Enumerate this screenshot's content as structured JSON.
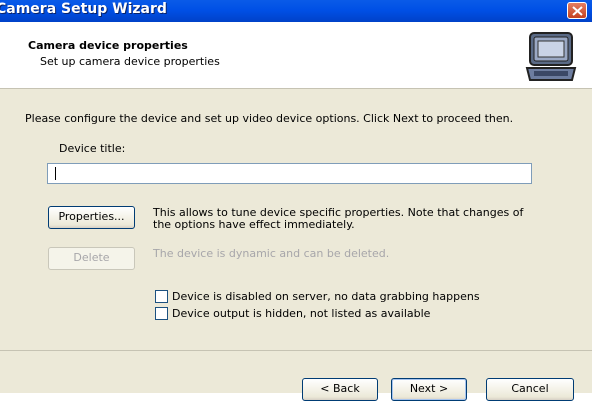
{
  "window": {
    "title": "Camera Setup Wizard"
  },
  "header": {
    "title": "Camera device properties",
    "subtitle": "Set up camera device properties",
    "icon": "camera-case-icon"
  },
  "content": {
    "intro": "Please configure the device and set up video device options. Click Next to proceed then.",
    "device_title_label": "Device title:",
    "device_title_value": "",
    "properties_button": "Properties...",
    "properties_desc": "This allows to tune device specific properties. Note that changes of the options have effect immediately.",
    "delete_button": "Delete",
    "delete_desc": "The device is dynamic and can be deleted.",
    "checkboxes": [
      {
        "label": "Device is disabled on server, no data grabbing happens",
        "checked": false
      },
      {
        "label": "Device output is hidden, not listed as available",
        "checked": false
      }
    ]
  },
  "footer": {
    "back": "< Back",
    "next": "Next >",
    "cancel": "Cancel"
  },
  "colors": {
    "titlebar": "#0050e6",
    "dialog_bg": "#ece9d8",
    "close": "#c4411f"
  }
}
